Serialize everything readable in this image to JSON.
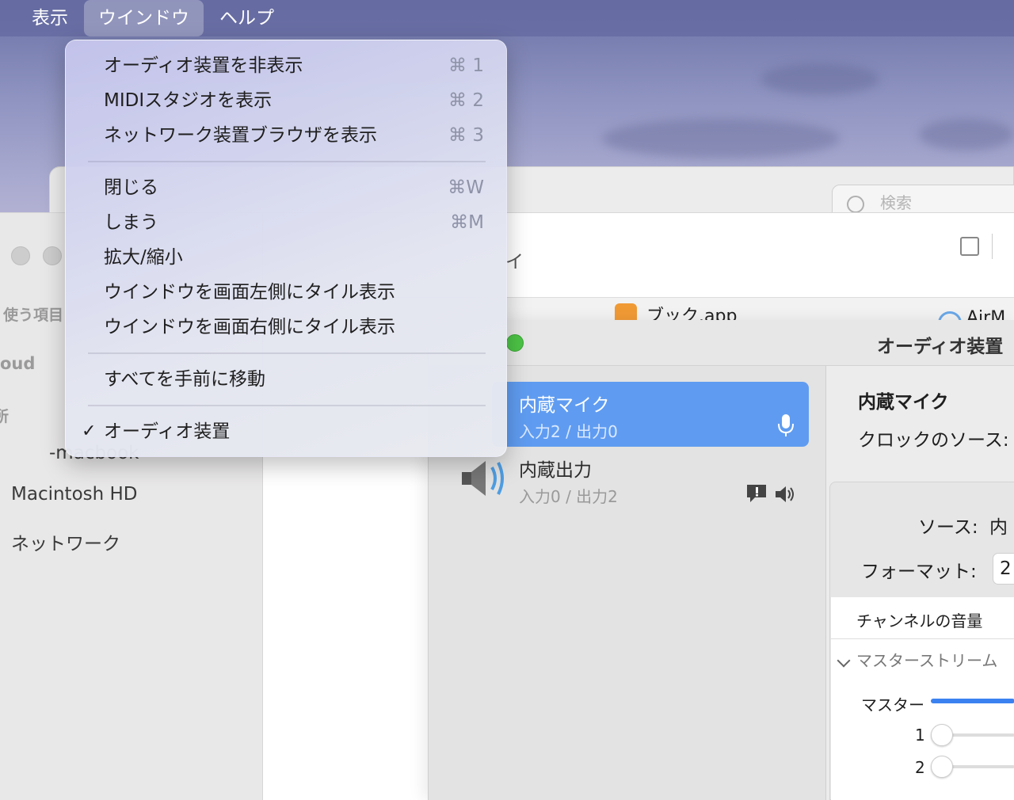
{
  "menubar": {
    "items": [
      "表示",
      "ウインドウ",
      "ヘルプ"
    ]
  },
  "window_menu": {
    "group1": [
      {
        "label": "オーディオ装置を非表示",
        "shortcut": "⌘ 1"
      },
      {
        "label": "MIDIスタジオを表示",
        "shortcut": "⌘ 2"
      },
      {
        "label": "ネットワーク装置ブラウザを表示",
        "shortcut": "⌘ 3"
      }
    ],
    "group2": [
      {
        "label": "閉じる",
        "shortcut": "⌘W"
      },
      {
        "label": "しまう",
        "shortcut": "⌘M"
      },
      {
        "label": "拡大/縮小",
        "shortcut": ""
      },
      {
        "label": "ウインドウを画面左側にタイル表示",
        "shortcut": ""
      },
      {
        "label": "ウインドウを画面右側にタイル表示",
        "shortcut": ""
      }
    ],
    "group3": [
      {
        "label": "すべてを手前に移動"
      }
    ],
    "group4": [
      {
        "label": "オーディオ装置",
        "checked": "✓"
      }
    ]
  },
  "finder": {
    "search_placeholder": "検索",
    "sidebar": {
      "section_favorites": "使う項目",
      "section_icloud": "oud",
      "section_locations": "所",
      "device": "-macbook",
      "disk": "Macintosh HD",
      "network": "ネットワーク"
    },
    "title_fragment": "イ",
    "apps": [
      "ブック.app",
      "AirM"
    ]
  },
  "audio_window": {
    "title": "オーディオ装置",
    "devices": [
      {
        "name": "内蔵マイク",
        "io": "入力2 / 出力0"
      },
      {
        "name": "内蔵出力",
        "io": "入力0 / 出力2"
      }
    ],
    "detail": {
      "device_name": "内蔵マイク",
      "clock_label": "クロックのソース:",
      "source_label": "ソース:",
      "source_value": "内",
      "format_label": "フォーマット:",
      "format_value": "2",
      "channel_volume": "チャンネルの音量",
      "master_stream": "マスターストリーム",
      "master": "マスター",
      "channels": [
        "1",
        "2"
      ]
    }
  },
  "colors": {
    "selection": "#5f9cf1",
    "menubar": "#646aa0"
  }
}
